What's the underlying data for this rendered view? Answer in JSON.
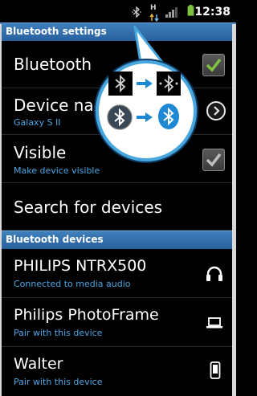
{
  "status_bar": {
    "time": "12:38",
    "net": "H",
    "icons": [
      "bluetooth-icon",
      "data-arrows-icon",
      "signal-icon",
      "battery-icon"
    ]
  },
  "sections": {
    "bluetooth_settings": "Bluetooth settings",
    "bluetooth_devices": "Bluetooth devices"
  },
  "settings": {
    "bluetooth": {
      "label": "Bluetooth",
      "checked": true
    },
    "device_name": {
      "label": "Device name",
      "value": "Galaxy S II"
    },
    "visible": {
      "label": "Visible",
      "sub": "Make device visible",
      "checked": true
    },
    "search": {
      "label": "Search for devices"
    }
  },
  "devices": [
    {
      "name": "PHILIPS NTRX500",
      "status": "Connected to media audio",
      "icon": "headphones-icon"
    },
    {
      "name": "Philips PhotoFrame",
      "status": "Pair with this device",
      "icon": "laptop-icon"
    },
    {
      "name": "Walter",
      "status": "Pair with this device",
      "icon": "phone-icon"
    }
  ],
  "callout": {
    "icons": [
      "bluetooth-icon",
      "bluetooth-connected-icon",
      "bluetooth-circle-icon",
      "bluetooth-active-icon"
    ]
  },
  "colors": {
    "header": "#2f6fb0",
    "accent_blue": "#4aa6e6",
    "check_green": "#7fc241",
    "arrow_blue": "#1d88d4"
  }
}
